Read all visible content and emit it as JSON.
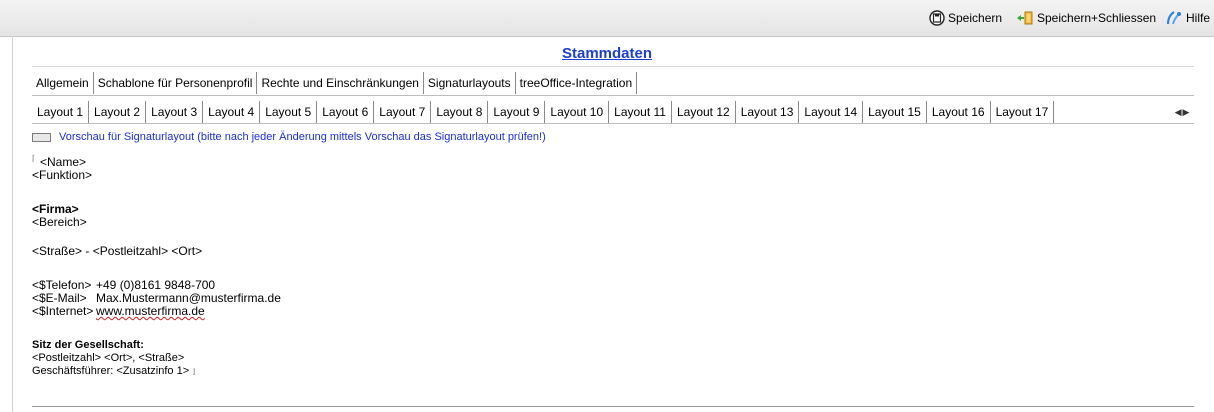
{
  "toolbar": {
    "save_label": "Speichern",
    "save_close_label": "Speichern+Schliessen",
    "help_label": "Hilfe"
  },
  "page_title": "Stammdaten",
  "main_tabs": [
    {
      "label": "Allgemein",
      "active": false
    },
    {
      "label": "Schablone für Personenprofil",
      "active": false
    },
    {
      "label": "Rechte und Einschränkungen",
      "active": false
    },
    {
      "label": "Signaturlayouts",
      "active": true
    },
    {
      "label": "treeOffice-Integration",
      "active": false
    }
  ],
  "layout_tabs": [
    {
      "label": "Layout 1",
      "active": false
    },
    {
      "label": "Layout 2",
      "active": false
    },
    {
      "label": "Layout 3",
      "active": false
    },
    {
      "label": "Layout 4",
      "active": false
    },
    {
      "label": "Layout 5",
      "active": false
    },
    {
      "label": "Layout 6",
      "active": false
    },
    {
      "label": "Layout 7",
      "active": false
    },
    {
      "label": "Layout 8",
      "active": false
    },
    {
      "label": "Layout 9",
      "active": false
    },
    {
      "label": "Layout 10",
      "active": false
    },
    {
      "label": "Layout 11",
      "active": false
    },
    {
      "label": "Layout 12",
      "active": true
    },
    {
      "label": "Layout 13",
      "active": false
    },
    {
      "label": "Layout 14",
      "active": false
    },
    {
      "label": "Layout 15",
      "active": false
    },
    {
      "label": "Layout 16",
      "active": false
    },
    {
      "label": "Layout 17",
      "active": false
    }
  ],
  "preview": {
    "label": "Vorschau für Signaturlayout (bitte nach jeder Änderung mittels Vorschau das Signaturlayout prüfen!)",
    "checked": false
  },
  "signature": {
    "name": "<Name>",
    "function": "<Funktion>",
    "company": "<Firma>",
    "department": "<Bereich>",
    "address_line": "<Straße> - <Postleitzahl> <Ort>",
    "contacts": [
      {
        "label": "<$Telefon>",
        "value": "+49 (0)8161 9848-700"
      },
      {
        "label": "<$E-Mail>",
        "value": "Max.Mustermann@musterfirma.de"
      },
      {
        "label": "<$Internet>",
        "value": "www.musterfirma.de"
      }
    ],
    "seat_heading": "Sitz der Gesellschaft:",
    "seat_address": "<Postleitzahl> <Ort>, <Straße>",
    "ceo_line": "Geschäftsführer: <Zusatzinfo 1>"
  }
}
